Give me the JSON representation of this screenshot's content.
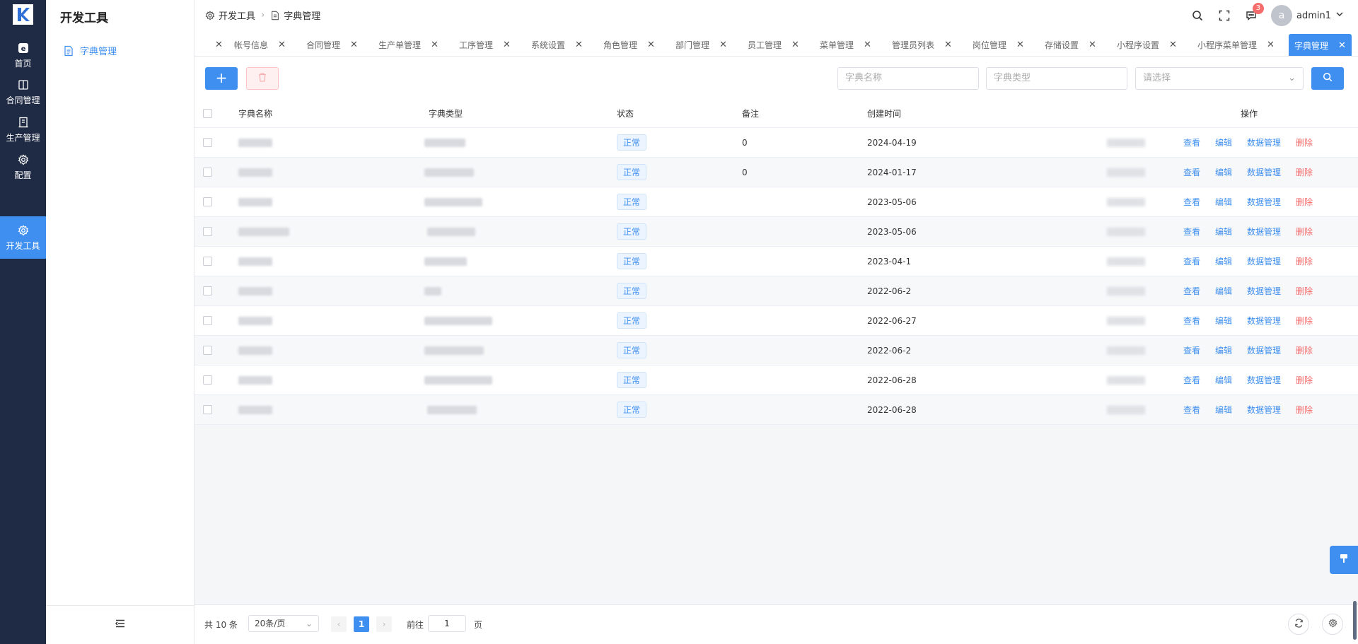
{
  "rail": {
    "items": [
      {
        "label": "首页",
        "icon": "home-icon"
      },
      {
        "label": "合同管理",
        "icon": "book-icon"
      },
      {
        "label": "生产管理",
        "icon": "building-icon"
      },
      {
        "label": "配置",
        "icon": "gear-icon"
      },
      {
        "label": "开发工具",
        "icon": "gear-icon"
      }
    ],
    "active": "开发工具"
  },
  "sidebar": {
    "title": "开发工具",
    "items": [
      {
        "label": "字典管理",
        "icon": "document-icon"
      }
    ]
  },
  "header": {
    "breadcrumb": [
      "开发工具",
      "字典管理"
    ],
    "notifications": "3",
    "avatar_letter": "a",
    "username": "admin1"
  },
  "tabs": [
    {
      "label": "帐号信息"
    },
    {
      "label": "合同管理"
    },
    {
      "label": "生产单管理"
    },
    {
      "label": "工序管理"
    },
    {
      "label": "系统设置"
    },
    {
      "label": "角色管理"
    },
    {
      "label": "部门管理"
    },
    {
      "label": "员工管理"
    },
    {
      "label": "菜单管理"
    },
    {
      "label": "管理员列表"
    },
    {
      "label": "岗位管理"
    },
    {
      "label": "存储设置"
    },
    {
      "label": "小程序设置"
    },
    {
      "label": "小程序菜单管理"
    },
    {
      "label": "字典管理",
      "active": true
    }
  ],
  "toolbar": {
    "add_label": "+",
    "search_name_placeholder": "字典名称",
    "search_type_placeholder": "字典类型",
    "status_placeholder": "请选择"
  },
  "table": {
    "columns": [
      "字典名称",
      "字典类型",
      "状态",
      "备注",
      "创建时间",
      "操作"
    ],
    "rows": [
      {
        "status": "正常",
        "remark": "0",
        "created": "2024-04-19"
      },
      {
        "status": "正常",
        "remark": "0",
        "created": "2024-01-17"
      },
      {
        "status": "正常",
        "remark": "",
        "created": "2023-05-06"
      },
      {
        "status": "正常",
        "remark": "",
        "created": "2023-05-06"
      },
      {
        "status": "正常",
        "remark": "",
        "created": "2023-04-1"
      },
      {
        "status": "正常",
        "remark": "",
        "created": "2022-06-2"
      },
      {
        "status": "正常",
        "remark": "",
        "created": "2022-06-27"
      },
      {
        "status": "正常",
        "remark": "",
        "created": "2022-06-2"
      },
      {
        "status": "正常",
        "remark": "",
        "created": "2022-06-28"
      },
      {
        "status": "正常",
        "remark": "",
        "created": "2022-06-28"
      }
    ],
    "actions": {
      "view": "查看",
      "edit": "编辑",
      "data": "数据管理",
      "delete": "删除"
    }
  },
  "footer": {
    "total": "共 10 条",
    "page_size": "20条/页",
    "current_page": "1",
    "goto_label": "前往",
    "goto_value": "1",
    "goto_suffix": "页"
  },
  "colors": {
    "primary": "#3f8ff0",
    "danger": "#f56c6c",
    "rail": "#1f2a44"
  }
}
